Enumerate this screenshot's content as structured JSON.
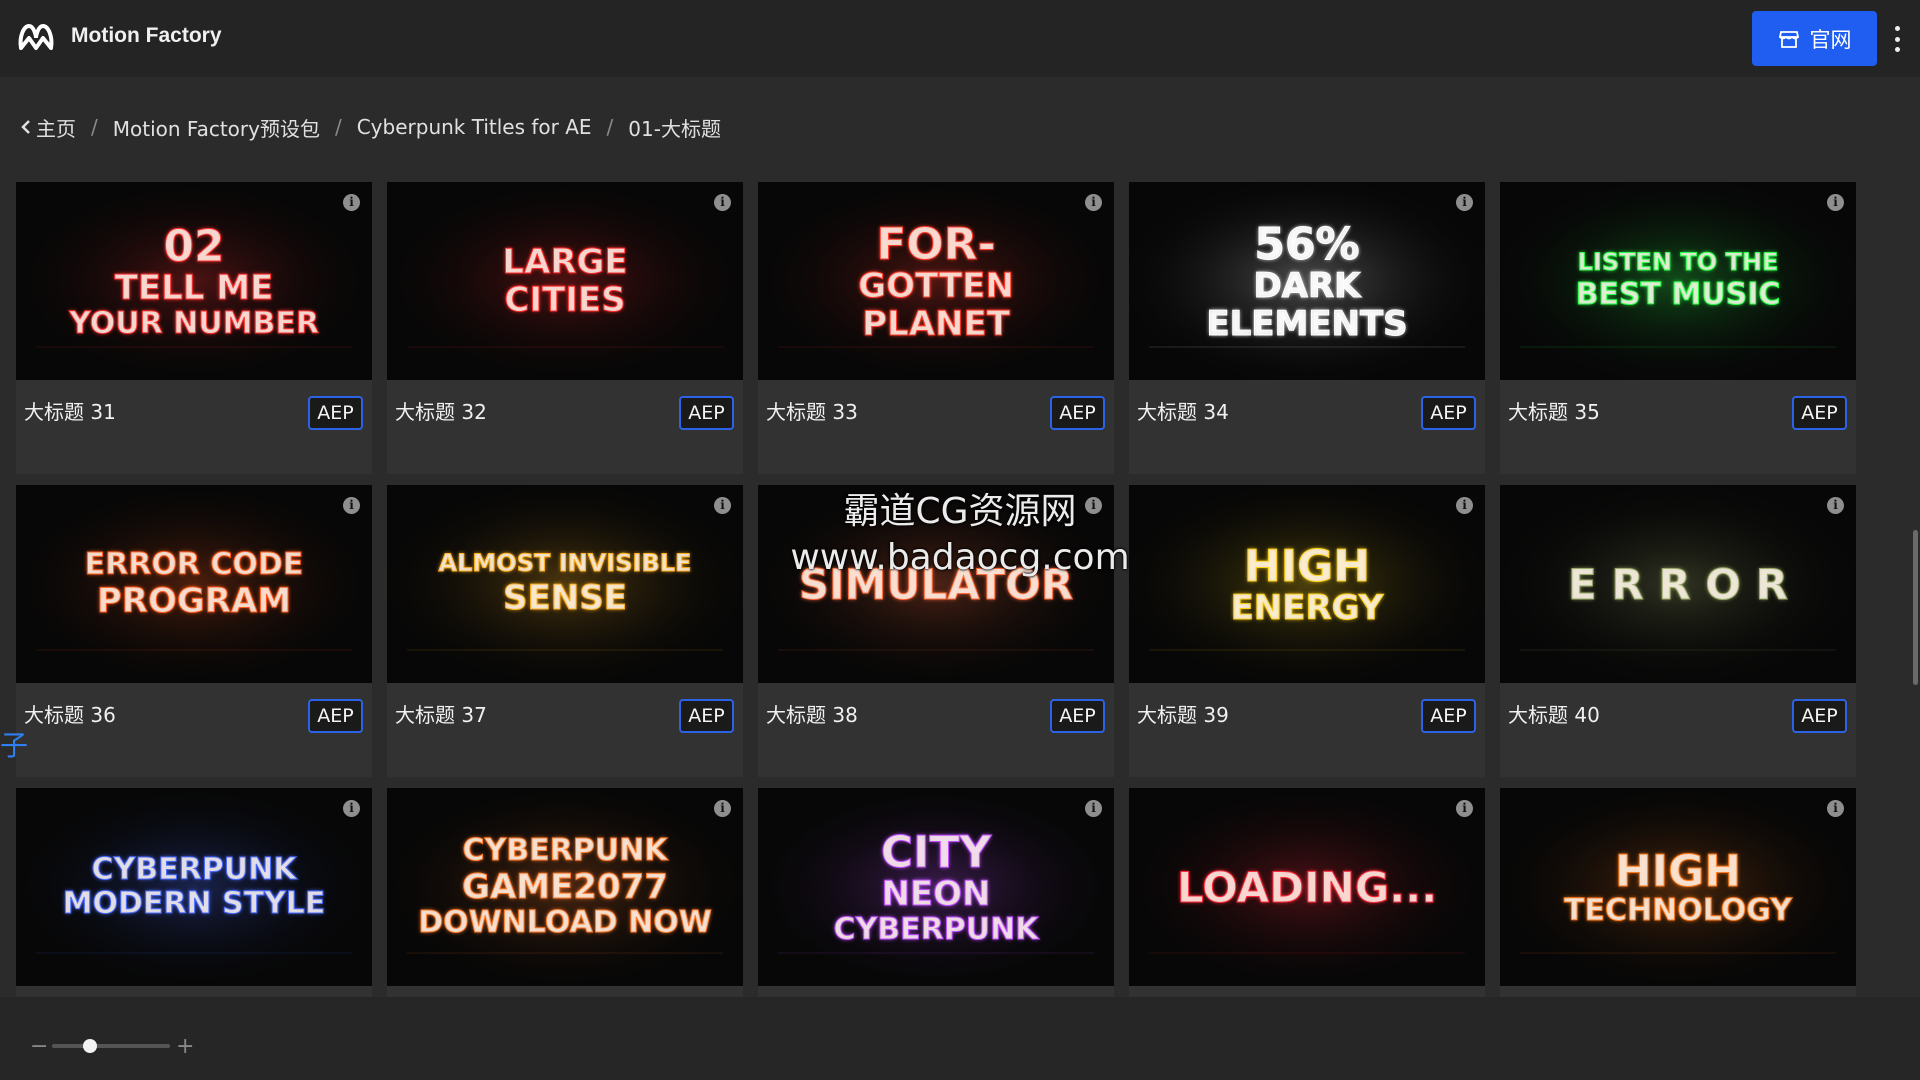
{
  "app": {
    "title": "Motion Factory",
    "site_button_label": "官网"
  },
  "breadcrumb": {
    "items": [
      "主页",
      "Motion Factory预设包",
      "Cyberpunk Titles for AE",
      "01-大标题"
    ]
  },
  "cards": [
    {
      "label": "大标题 31",
      "badge": "AEP",
      "thumb_text": [
        "02",
        "TELL ME",
        "YOUR NUMBER"
      ],
      "glow": "#ff3030"
    },
    {
      "label": "大标题 32",
      "badge": "AEP",
      "thumb_text": [
        "LARGE",
        "CITIES"
      ],
      "glow": "#ff2a2a"
    },
    {
      "label": "大标题 33",
      "badge": "AEP",
      "thumb_text": [
        "FOR-",
        "GOTTEN",
        "PLANET"
      ],
      "glow": "#ff3a2a"
    },
    {
      "label": "大标题 34",
      "badge": "AEP",
      "thumb_text": [
        "56%",
        "DARK",
        "ELEMENTS"
      ],
      "glow": "#ffffff"
    },
    {
      "label": "大标题 35",
      "badge": "AEP",
      "thumb_text": [
        "LISTEN TO THE",
        "BEST MUSIC"
      ],
      "glow": "#2cff4a"
    },
    {
      "label": "大标题 36",
      "badge": "AEP",
      "thumb_text": [
        "ERROR CODE",
        "PROGRAM"
      ],
      "glow": "#ff5a1a"
    },
    {
      "label": "大标题 37",
      "badge": "AEP",
      "thumb_text": [
        "ALMOST INVISIBLE",
        "SENSE"
      ],
      "glow": "#ffb020"
    },
    {
      "label": "大标题 38",
      "badge": "AEP",
      "thumb_text": [
        "SIMULATOR"
      ],
      "glow": "#ff6a3a"
    },
    {
      "label": "大标题 39",
      "badge": "AEP",
      "thumb_text": [
        "HIGH",
        "ENERGY"
      ],
      "glow": "#ffd21a"
    },
    {
      "label": "大标题 40",
      "badge": "AEP",
      "thumb_text": [
        "E R R O R"
      ],
      "glow": "#9aa866"
    },
    {
      "label": "",
      "badge": "",
      "thumb_text": [
        "CYBERPUNK",
        "MODERN STYLE"
      ],
      "glow": "#4a6bff"
    },
    {
      "label": "",
      "badge": "",
      "thumb_text": [
        "CYBERPUNK",
        "GAME2077",
        "DOWNLOAD NOW"
      ],
      "glow": "#ff7a2a"
    },
    {
      "label": "",
      "badge": "",
      "thumb_text": [
        "CITY",
        "NEON",
        "CYBERPUNK"
      ],
      "glow": "#c050ff"
    },
    {
      "label": "",
      "badge": "",
      "thumb_text": [
        "LOADING..."
      ],
      "glow": "#ff2a3a"
    },
    {
      "label": "",
      "badge": "",
      "thumb_text": [
        "HIGH",
        "TECHNOLOGY"
      ],
      "glow": "#ff7a1a"
    }
  ],
  "watermark": {
    "line1": "霸道CG资源网",
    "line2": "www.badaocg.com"
  },
  "edge_char": "子",
  "zoom": {
    "minus": "−",
    "plus": "+",
    "value_fraction": 0.2
  },
  "colors": {
    "accent": "#1f5ef0",
    "badge_border": "#2c63e6"
  },
  "icons": [
    "motion-factory-logo-icon",
    "store-icon",
    "more-vertical-icon",
    "chevron-left-icon",
    "info-icon"
  ]
}
